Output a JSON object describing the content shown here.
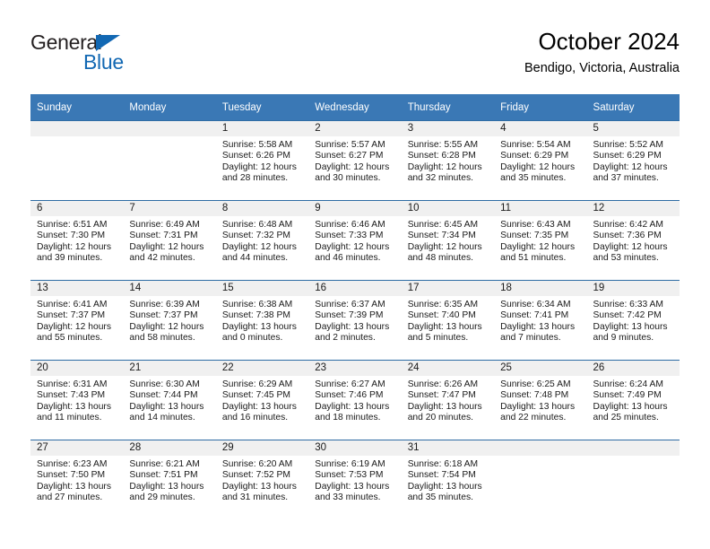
{
  "logo": {
    "word_one": "General",
    "word_two": "Blue",
    "triangle_color": "#1268b3",
    "text_color": "#231f20"
  },
  "header": {
    "title": "October 2024",
    "subtitle": "Bendigo, Victoria, Australia"
  },
  "theme": {
    "header_blue": "#3a78b5",
    "row_divider_blue": "#2e6ca4",
    "date_strip_gray": "#f0f0f0"
  },
  "calendar": {
    "weekday_headers": [
      "Sunday",
      "Monday",
      "Tuesday",
      "Wednesday",
      "Thursday",
      "Friday",
      "Saturday"
    ],
    "weeks": [
      [
        {
          "day": "",
          "lines": []
        },
        {
          "day": "",
          "lines": []
        },
        {
          "day": "1",
          "lines": [
            "Sunrise: 5:58 AM",
            "Sunset: 6:26 PM",
            "Daylight: 12 hours",
            "and 28 minutes."
          ]
        },
        {
          "day": "2",
          "lines": [
            "Sunrise: 5:57 AM",
            "Sunset: 6:27 PM",
            "Daylight: 12 hours",
            "and 30 minutes."
          ]
        },
        {
          "day": "3",
          "lines": [
            "Sunrise: 5:55 AM",
            "Sunset: 6:28 PM",
            "Daylight: 12 hours",
            "and 32 minutes."
          ]
        },
        {
          "day": "4",
          "lines": [
            "Sunrise: 5:54 AM",
            "Sunset: 6:29 PM",
            "Daylight: 12 hours",
            "and 35 minutes."
          ]
        },
        {
          "day": "5",
          "lines": [
            "Sunrise: 5:52 AM",
            "Sunset: 6:29 PM",
            "Daylight: 12 hours",
            "and 37 minutes."
          ]
        }
      ],
      [
        {
          "day": "6",
          "lines": [
            "Sunrise: 6:51 AM",
            "Sunset: 7:30 PM",
            "Daylight: 12 hours",
            "and 39 minutes."
          ]
        },
        {
          "day": "7",
          "lines": [
            "Sunrise: 6:49 AM",
            "Sunset: 7:31 PM",
            "Daylight: 12 hours",
            "and 42 minutes."
          ]
        },
        {
          "day": "8",
          "lines": [
            "Sunrise: 6:48 AM",
            "Sunset: 7:32 PM",
            "Daylight: 12 hours",
            "and 44 minutes."
          ]
        },
        {
          "day": "9",
          "lines": [
            "Sunrise: 6:46 AM",
            "Sunset: 7:33 PM",
            "Daylight: 12 hours",
            "and 46 minutes."
          ]
        },
        {
          "day": "10",
          "lines": [
            "Sunrise: 6:45 AM",
            "Sunset: 7:34 PM",
            "Daylight: 12 hours",
            "and 48 minutes."
          ]
        },
        {
          "day": "11",
          "lines": [
            "Sunrise: 6:43 AM",
            "Sunset: 7:35 PM",
            "Daylight: 12 hours",
            "and 51 minutes."
          ]
        },
        {
          "day": "12",
          "lines": [
            "Sunrise: 6:42 AM",
            "Sunset: 7:36 PM",
            "Daylight: 12 hours",
            "and 53 minutes."
          ]
        }
      ],
      [
        {
          "day": "13",
          "lines": [
            "Sunrise: 6:41 AM",
            "Sunset: 7:37 PM",
            "Daylight: 12 hours",
            "and 55 minutes."
          ]
        },
        {
          "day": "14",
          "lines": [
            "Sunrise: 6:39 AM",
            "Sunset: 7:37 PM",
            "Daylight: 12 hours",
            "and 58 minutes."
          ]
        },
        {
          "day": "15",
          "lines": [
            "Sunrise: 6:38 AM",
            "Sunset: 7:38 PM",
            "Daylight: 13 hours",
            "and 0 minutes."
          ]
        },
        {
          "day": "16",
          "lines": [
            "Sunrise: 6:37 AM",
            "Sunset: 7:39 PM",
            "Daylight: 13 hours",
            "and 2 minutes."
          ]
        },
        {
          "day": "17",
          "lines": [
            "Sunrise: 6:35 AM",
            "Sunset: 7:40 PM",
            "Daylight: 13 hours",
            "and 5 minutes."
          ]
        },
        {
          "day": "18",
          "lines": [
            "Sunrise: 6:34 AM",
            "Sunset: 7:41 PM",
            "Daylight: 13 hours",
            "and 7 minutes."
          ]
        },
        {
          "day": "19",
          "lines": [
            "Sunrise: 6:33 AM",
            "Sunset: 7:42 PM",
            "Daylight: 13 hours",
            "and 9 minutes."
          ]
        }
      ],
      [
        {
          "day": "20",
          "lines": [
            "Sunrise: 6:31 AM",
            "Sunset: 7:43 PM",
            "Daylight: 13 hours",
            "and 11 minutes."
          ]
        },
        {
          "day": "21",
          "lines": [
            "Sunrise: 6:30 AM",
            "Sunset: 7:44 PM",
            "Daylight: 13 hours",
            "and 14 minutes."
          ]
        },
        {
          "day": "22",
          "lines": [
            "Sunrise: 6:29 AM",
            "Sunset: 7:45 PM",
            "Daylight: 13 hours",
            "and 16 minutes."
          ]
        },
        {
          "day": "23",
          "lines": [
            "Sunrise: 6:27 AM",
            "Sunset: 7:46 PM",
            "Daylight: 13 hours",
            "and 18 minutes."
          ]
        },
        {
          "day": "24",
          "lines": [
            "Sunrise: 6:26 AM",
            "Sunset: 7:47 PM",
            "Daylight: 13 hours",
            "and 20 minutes."
          ]
        },
        {
          "day": "25",
          "lines": [
            "Sunrise: 6:25 AM",
            "Sunset: 7:48 PM",
            "Daylight: 13 hours",
            "and 22 minutes."
          ]
        },
        {
          "day": "26",
          "lines": [
            "Sunrise: 6:24 AM",
            "Sunset: 7:49 PM",
            "Daylight: 13 hours",
            "and 25 minutes."
          ]
        }
      ],
      [
        {
          "day": "27",
          "lines": [
            "Sunrise: 6:23 AM",
            "Sunset: 7:50 PM",
            "Daylight: 13 hours",
            "and 27 minutes."
          ]
        },
        {
          "day": "28",
          "lines": [
            "Sunrise: 6:21 AM",
            "Sunset: 7:51 PM",
            "Daylight: 13 hours",
            "and 29 minutes."
          ]
        },
        {
          "day": "29",
          "lines": [
            "Sunrise: 6:20 AM",
            "Sunset: 7:52 PM",
            "Daylight: 13 hours",
            "and 31 minutes."
          ]
        },
        {
          "day": "30",
          "lines": [
            "Sunrise: 6:19 AM",
            "Sunset: 7:53 PM",
            "Daylight: 13 hours",
            "and 33 minutes."
          ]
        },
        {
          "day": "31",
          "lines": [
            "Sunrise: 6:18 AM",
            "Sunset: 7:54 PM",
            "Daylight: 13 hours",
            "and 35 minutes."
          ]
        },
        {
          "day": "",
          "lines": []
        },
        {
          "day": "",
          "lines": []
        }
      ]
    ]
  }
}
